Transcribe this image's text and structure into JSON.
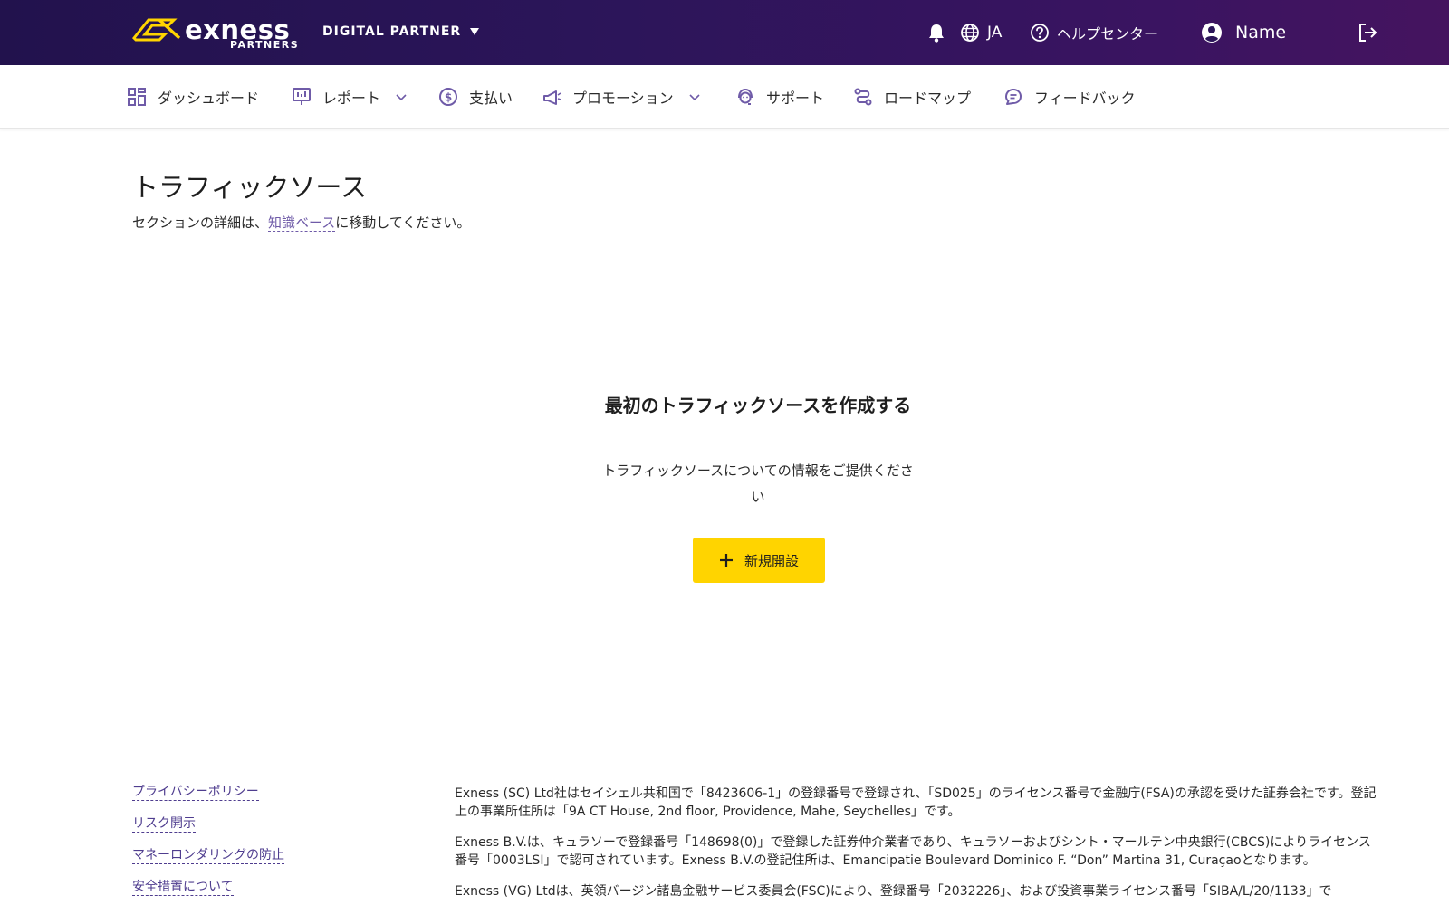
{
  "header": {
    "logo_text": "exness",
    "logo_sub": "PARTNERS",
    "partner_type": "DIGITAL PARTNER",
    "language": "JA",
    "help_center": "ヘルプセンター",
    "user_name": "Name"
  },
  "nav": {
    "items": [
      {
        "label": "ダッシュボード",
        "icon": "dashboard-icon",
        "has_dropdown": false
      },
      {
        "label": "レポート",
        "icon": "report-icon",
        "has_dropdown": true
      },
      {
        "label": "支払い",
        "icon": "dollar-icon",
        "has_dropdown": false
      },
      {
        "label": "プロモーション",
        "icon": "megaphone-icon",
        "has_dropdown": true
      },
      {
        "label": "サポート",
        "icon": "support-icon",
        "has_dropdown": false
      },
      {
        "label": "ロードマップ",
        "icon": "roadmap-icon",
        "has_dropdown": false
      },
      {
        "label": "フィードバック",
        "icon": "feedback-icon",
        "has_dropdown": false
      }
    ]
  },
  "main": {
    "title": "トラフィックソース",
    "desc_before": "セクションの詳細は、",
    "desc_link": "知識ベース",
    "desc_after": "に移動してください。",
    "empty_title": "最初のトラフィックソースを作成する",
    "empty_desc": "トラフィックソースについての情報をご提供ください",
    "new_button": "新規開設"
  },
  "footer": {
    "links": [
      "プライバシーポリシー",
      "リスク開示",
      "マネーロンダリングの防止",
      "安全措置について"
    ],
    "legal": [
      "Exness (SC) Ltd社はセイシェル共和国で「8423606-1」の登録番号で登録され、「SD025」のライセンス番号で金融庁(FSA)の承認を受けた証券会社です。登記上の事業所住所は「9A CT House, 2nd floor, Providence, Mahe, Seychelles」です。",
      "Exness B.V.は、キュラソーで登録番号「148698(0)」で登録した証券仲介業者であり、キュラソーおよびシント・マールテン中央銀行(CBCS)によりライセンス番号「0003LSI」で認可されています。Exness B.V.の登記住所は、Emancipatie Boulevard Dominico F. “Don” Martina 31, Curaçaoとなります。",
      "Exness (VG) Ltdは、英領バージン諸島金融サービス委員会(FSC)により、登録番号「2032226」、および投資事業ライセンス番号「SIBA/L/20/1133」で"
    ]
  },
  "colors": {
    "header_bg": "#2b1559",
    "accent_yellow": "#ffd400",
    "link_purple": "#6f5ba8",
    "icon_purple": "#6f5ba8"
  }
}
